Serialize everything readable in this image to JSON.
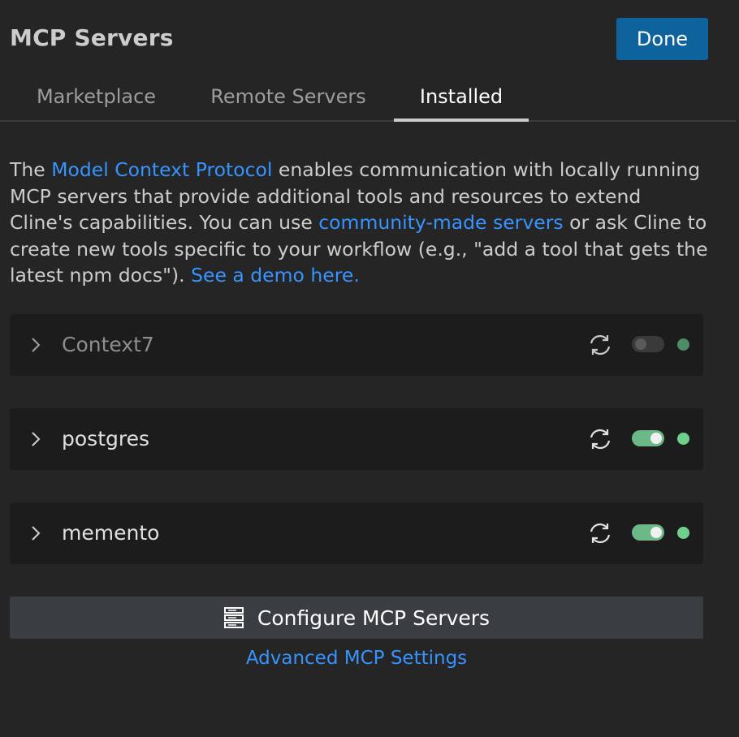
{
  "header": {
    "title": "MCP Servers",
    "done_label": "Done"
  },
  "tabs": [
    {
      "label": "Marketplace",
      "active": false
    },
    {
      "label": "Remote Servers",
      "active": false
    },
    {
      "label": "Installed",
      "active": true
    }
  ],
  "description": {
    "part1": "The ",
    "link1": "Model Context Protocol",
    "part2": " enables communication with locally running MCP servers that provide additional tools and resources to extend Cline's capabilities. You can use ",
    "link2": "community-made servers",
    "part3": " or ask Cline to create new tools specific to your workflow (e.g., \"add a tool that gets the latest npm docs\"). ",
    "link3": "See a demo here."
  },
  "servers": [
    {
      "name": "Context7",
      "enabled": false,
      "status": "connected"
    },
    {
      "name": "postgres",
      "enabled": true,
      "status": "connected"
    },
    {
      "name": "memento",
      "enabled": true,
      "status": "connected"
    }
  ],
  "configure_label": "Configure MCP Servers",
  "advanced_label": "Advanced MCP Settings",
  "icons": {
    "chevron": "chevron-right-icon",
    "restart": "refresh-icon",
    "configure": "server-icon"
  },
  "colors": {
    "accent": "#0e639c",
    "link": "#3794ff",
    "status_green": "#6ed08c",
    "toggle_on": "#6ab987"
  }
}
